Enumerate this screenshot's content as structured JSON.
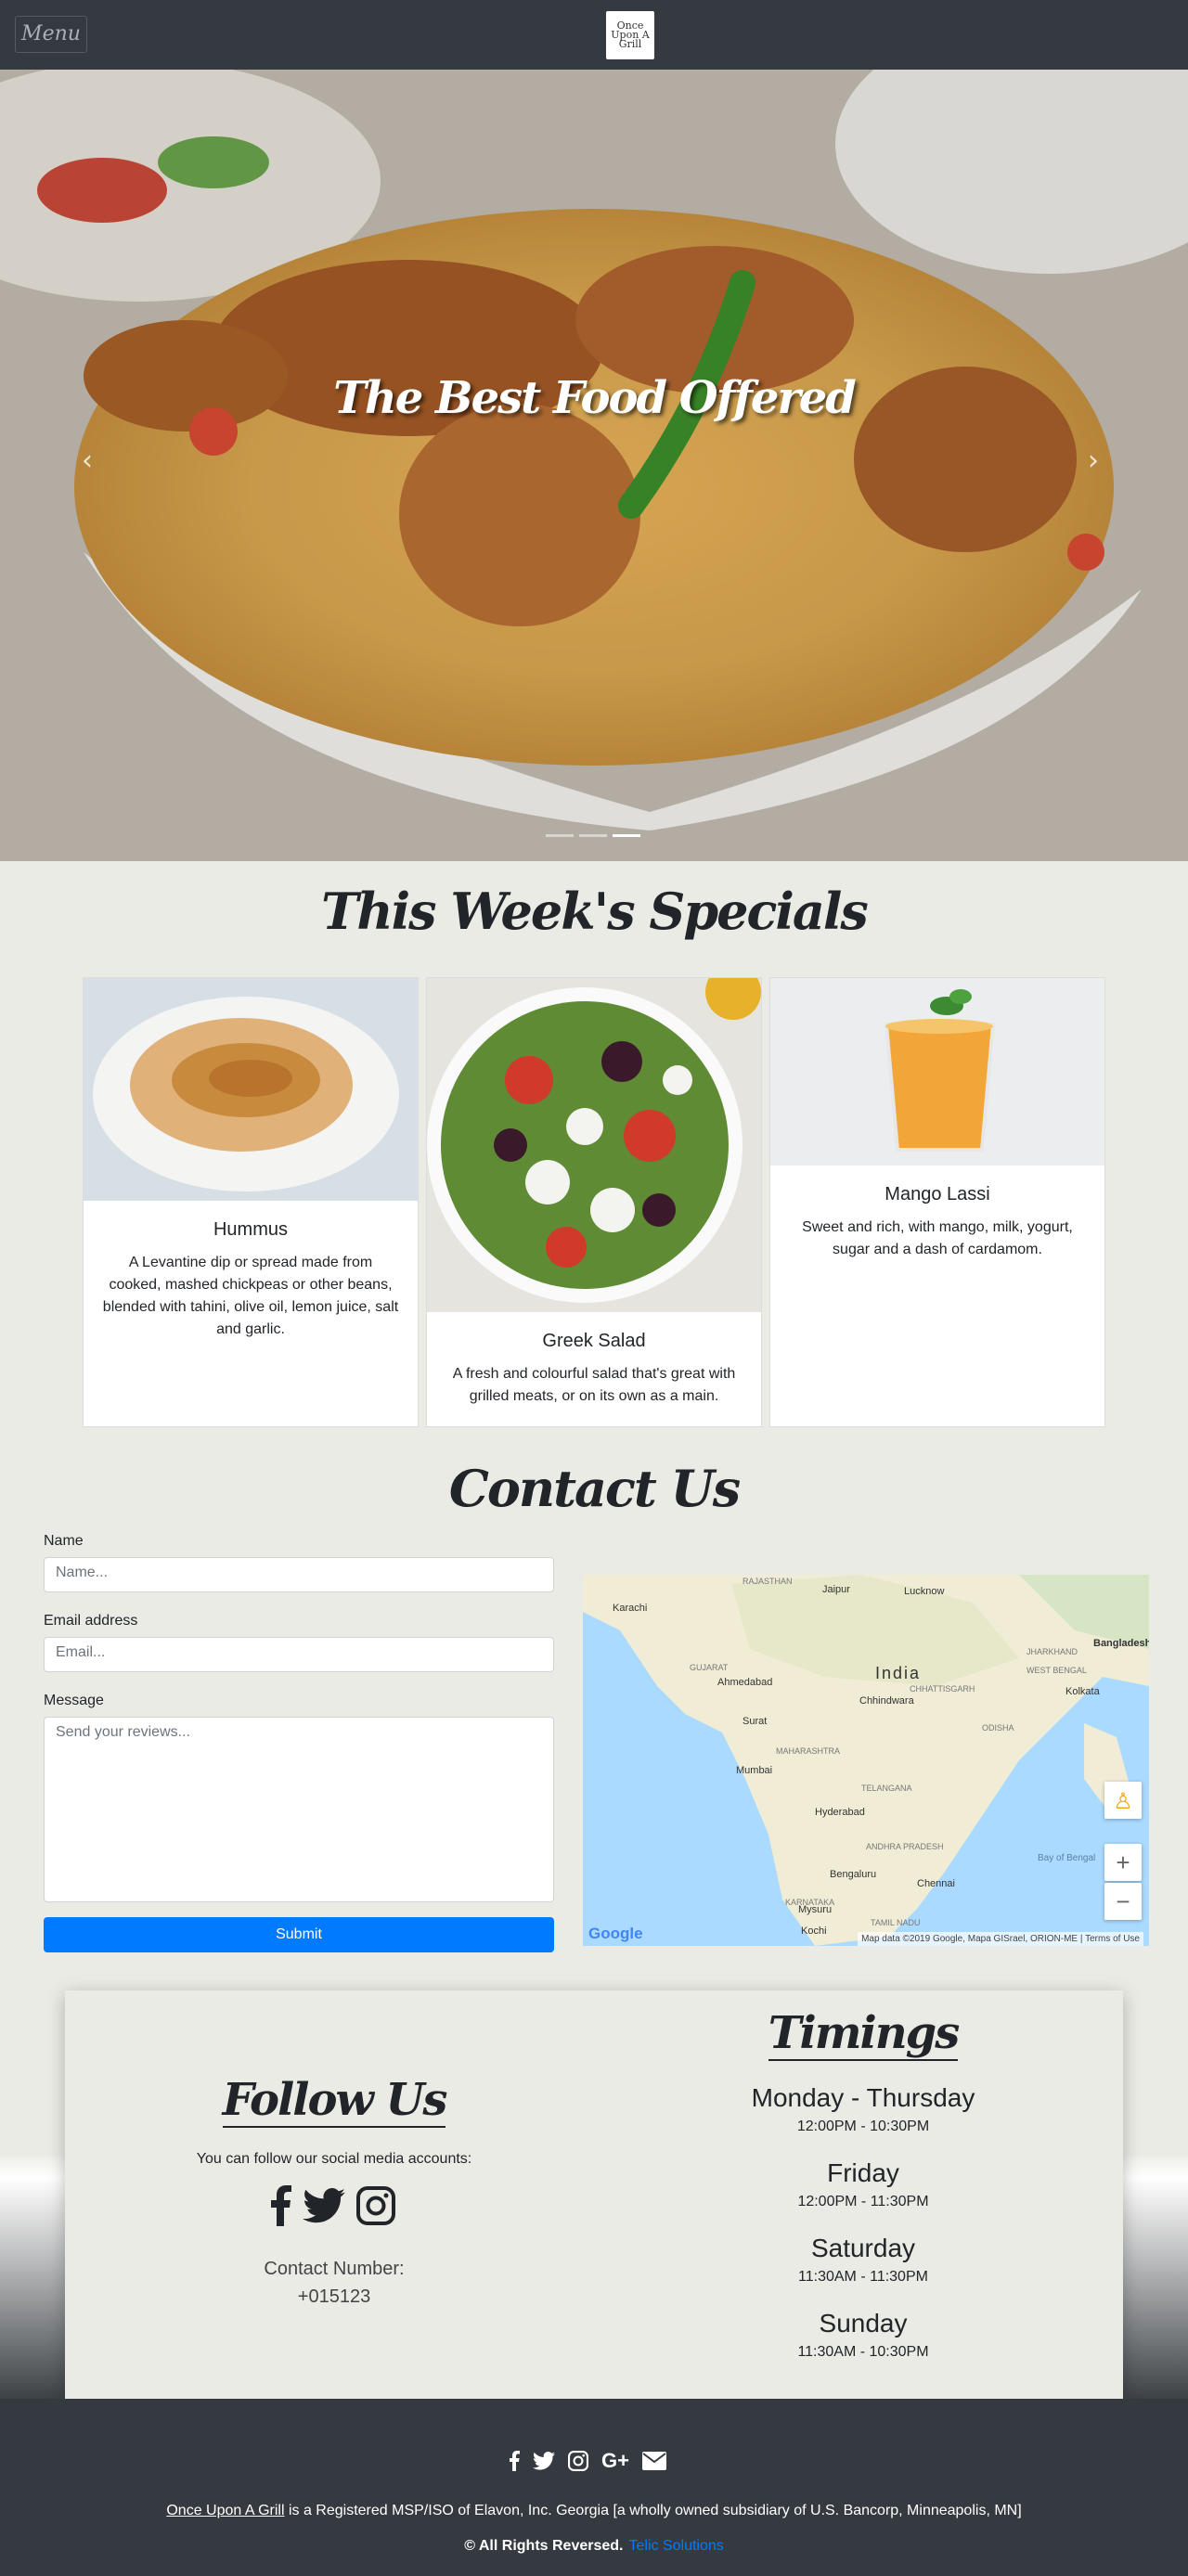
{
  "header": {
    "menu_label": "Menu",
    "logo_text": "Once Upon A Grill"
  },
  "hero": {
    "title": "The Best Food Offered",
    "prev_icon": "chevron-left-icon",
    "next_icon": "chevron-right-icon",
    "slide_count": 3,
    "active_slide": 3
  },
  "specials": {
    "title": "This Week's Specials",
    "items": [
      {
        "name": "Hummus",
        "description": "A Levantine dip or spread made from cooked, mashed chickpeas or other beans, blended with tahini, olive oil, lemon juice, salt and garlic."
      },
      {
        "name": "Greek Salad",
        "description": "A fresh and colourful salad that's great with grilled meats, or on its own as a main."
      },
      {
        "name": "Mango Lassi",
        "description": "Sweet and rich, with mango, milk, yogurt, sugar and a dash of cardamom."
      }
    ]
  },
  "contact": {
    "title": "Contact Us",
    "name_label": "Name",
    "name_placeholder": "Name...",
    "email_label": "Email address",
    "email_placeholder": "Email...",
    "message_label": "Message",
    "message_placeholder": "Send your reviews...",
    "submit_label": "Submit"
  },
  "map": {
    "labels": [
      "Karachi",
      "Jaipur",
      "Lucknow",
      "RAJASTHAN",
      "India",
      "GUJARAT",
      "Ahmedabad",
      "Surat",
      "Mumbai",
      "MAHARASHTRA",
      "Hyderabad",
      "TELANGANA",
      "Bengaluru",
      "Chennai",
      "KARNATAKA",
      "TAMIL NADU",
      "Kolkata",
      "WEST BENGAL",
      "JHARKHAND",
      "ODISHA",
      "CHHATTISGARH",
      "Chhindwara",
      "ANDHRA PRADESH",
      "Bay of Bengal",
      "Mysuru",
      "Kochi",
      "Bangladesh"
    ],
    "attribution": "Map data ©2019 Google, Mapa GISrael, ORION-ME",
    "terms": "Terms of Use",
    "google": "Google"
  },
  "follow": {
    "title": "Follow Us",
    "text": "You can follow our social media accounts:",
    "contact_label": "Contact Number:",
    "contact_number": "+015123"
  },
  "timings": {
    "title": "Timings",
    "days": [
      {
        "day": "Monday - Thursday",
        "hours": "12:00PM - 10:30PM"
      },
      {
        "day": "Friday",
        "hours": "12:00PM - 11:30PM"
      },
      {
        "day": "Saturday",
        "hours": "11:30AM - 11:30PM"
      },
      {
        "day": "Sunday",
        "hours": "11:30AM - 10:30PM"
      }
    ]
  },
  "footer": {
    "company_link": "Once Upon A Grill",
    "registration": " is a Registered MSP/ISO of Elavon, Inc. Georgia [a wholly owned subsidiary of U.S. Bancorp, Minneapolis, MN]",
    "copyright": "© All Rights Reversed.",
    "credit": "Telic Solutions"
  }
}
